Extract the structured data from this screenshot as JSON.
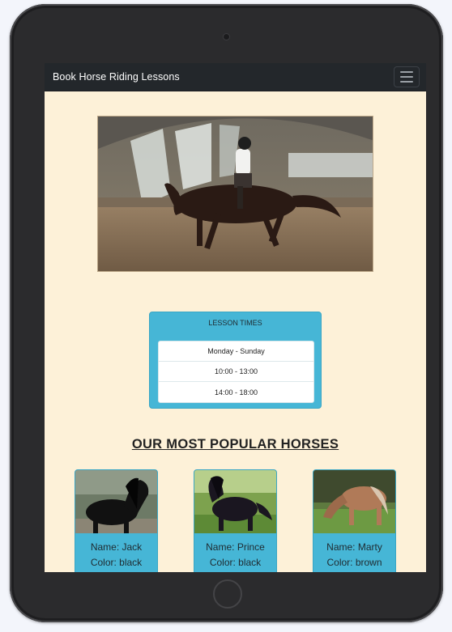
{
  "navbar": {
    "brand": "Book Horse Riding Lessons",
    "menu_icon": "hamburger-menu-icon"
  },
  "hero": {
    "image_icon": "horse-rider-photo"
  },
  "lesson_times": {
    "header": "LESSON TIMES",
    "items": [
      "Monday - Sunday",
      "10:00 - 13:00",
      "14:00 - 18:00"
    ],
    "accent_color": "#46b6d6"
  },
  "popular": {
    "title": "OUR MOST POPULAR HORSES",
    "horses": [
      {
        "name": "Name: Jack",
        "color": "Color: black"
      },
      {
        "name": "Name: Prince",
        "color": "Color: black"
      },
      {
        "name": "Name: Marty",
        "color": "Color: brown"
      }
    ]
  },
  "colors": {
    "page_background": "#fdf1d8",
    "navbar": "#23272b",
    "card": "#46b6d6"
  }
}
